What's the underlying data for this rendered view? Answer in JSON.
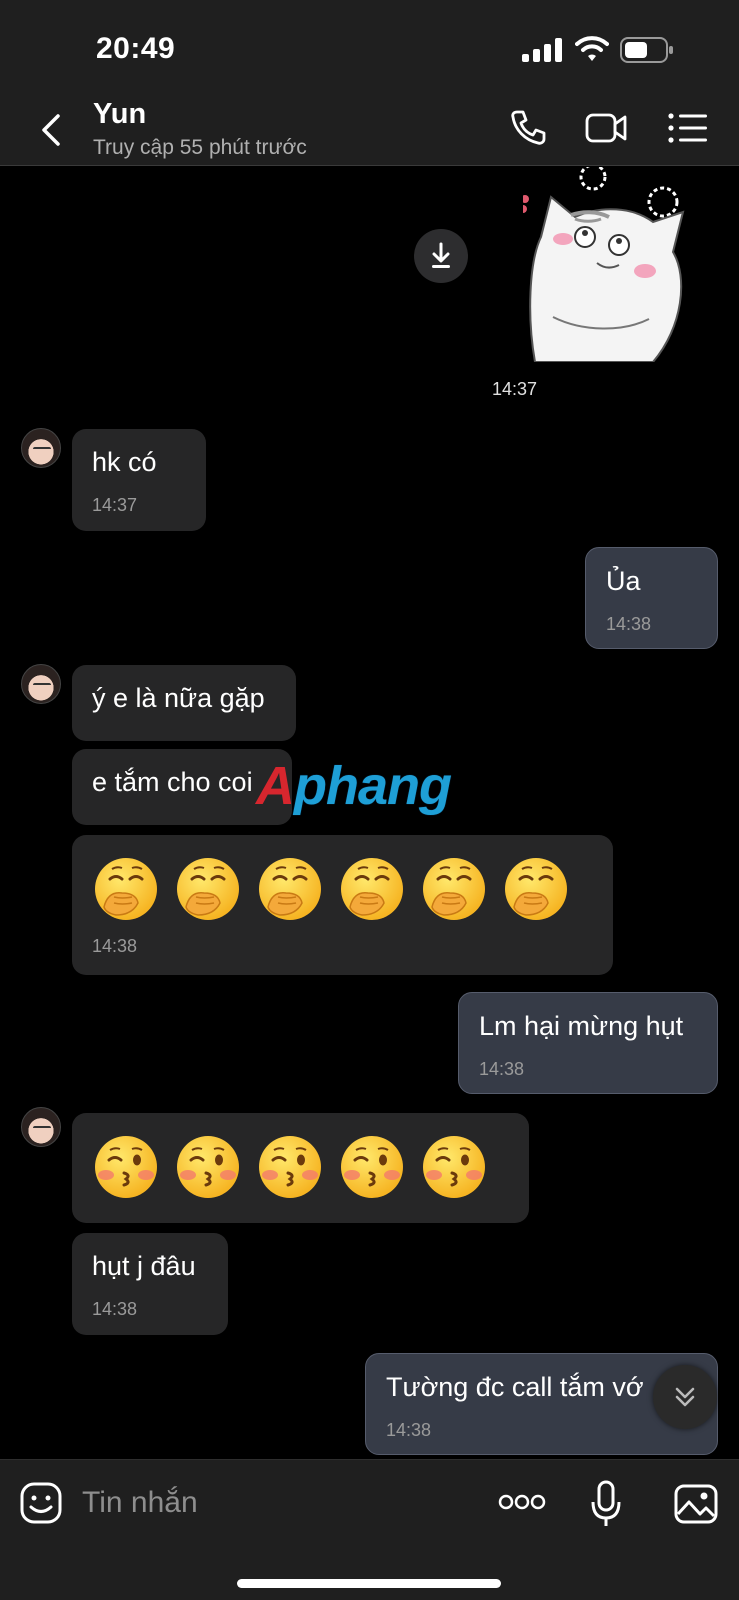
{
  "status_bar": {
    "time": "20:49"
  },
  "header": {
    "contact_name": "Yun",
    "contact_status": "Truy cập 55 phút trước"
  },
  "chat": {
    "sticker_time": "14:37",
    "messages": [
      {
        "direction": "in",
        "text": "hk có",
        "time": "14:37"
      },
      {
        "direction": "out",
        "text": "Ủa",
        "time": "14:38"
      },
      {
        "direction": "in",
        "text": "ý e là nữa gặp"
      },
      {
        "direction": "in",
        "text": "e tắm cho coi"
      },
      {
        "direction": "in",
        "emoji": "hand-over-mouth-emoji",
        "emoji_count": 6,
        "time": "14:38"
      },
      {
        "direction": "out",
        "text": "Lm hại mừng hụt",
        "time": "14:38"
      },
      {
        "direction": "in",
        "emoji": "kissing-emoji",
        "emoji_count": 5
      },
      {
        "direction": "in",
        "text": "hụt j đâu",
        "time": "14:38"
      },
      {
        "direction": "out",
        "text": "Tường đc call tắm vớ",
        "time": "14:38"
      }
    ]
  },
  "watermark": {
    "part1": "A",
    "part2": "phang"
  },
  "composer": {
    "placeholder": "Tin nhắn"
  },
  "colors": {
    "background": "#000000",
    "bar": "#1f1f1f",
    "incoming_bubble": "#262627",
    "outgoing_bubble": "#363b47"
  }
}
